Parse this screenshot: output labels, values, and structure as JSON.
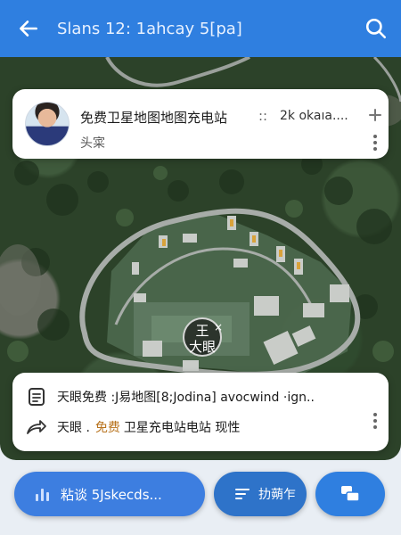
{
  "header": {
    "title": "Slans 12: 1ahcay 5[pa]"
  },
  "top_card": {
    "name": "免费卫星地图地图充电站",
    "separator": "::",
    "meta": "2k okaıa....",
    "subtitle": "头寀"
  },
  "map": {
    "marker_label_line1": "王",
    "marker_label_line2": "大眼",
    "marker_close": "×"
  },
  "bottom_card": {
    "line1": "天眼免费 :J易地图[8;Jodina] avocwind ·ign..",
    "line2_prefix": "天眼 .",
    "line2_highlight": "免费",
    "line2_rest": "卫星充电站电站 现性",
    "highlight_color": "#b8731e"
  },
  "bottom_bar": {
    "search_label": "粘谈 5Jskecds...",
    "filter_label": "扐蒴乍"
  },
  "colors": {
    "primary": "#2f7fe0",
    "map_bg": "#2c4229"
  }
}
